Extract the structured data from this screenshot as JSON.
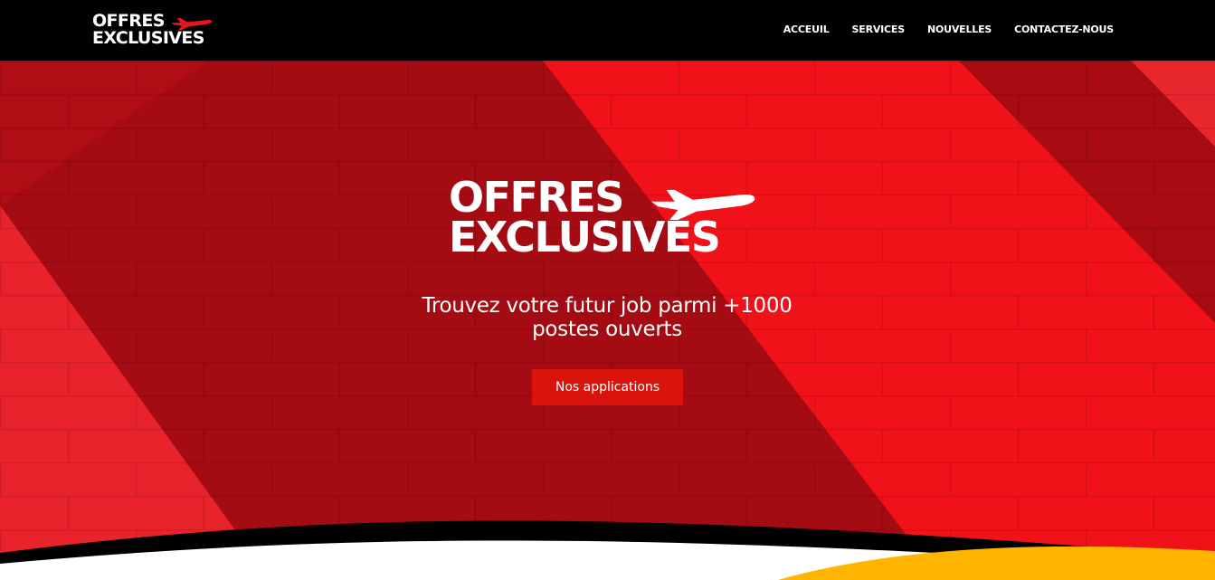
{
  "header": {
    "logo": {
      "line1": "OFFRES",
      "line2": "EXCLUSIVES"
    },
    "nav": [
      {
        "label": "ACCEUIL"
      },
      {
        "label": "SERVICES"
      },
      {
        "label": "NOUVELLES"
      },
      {
        "label": "CONTACTEZ-NOUS"
      }
    ]
  },
  "hero": {
    "logo": {
      "line1": "OFFRES",
      "line2": "EXCLUSIVES"
    },
    "tagline_line1": "Trouvez votre futur job parmi +1000",
    "tagline_line2": "postes ouverts",
    "cta_label": "Nos applications"
  },
  "icons": {
    "logo_icon": "airplane-icon"
  },
  "colors": {
    "header_bg": "#000000",
    "hero_red": "#e8141c",
    "hero_dark_red": "#a80b12",
    "cta_bg": "#d8140c",
    "wave_yellow": "#ffb400",
    "text": "#ffffff"
  }
}
